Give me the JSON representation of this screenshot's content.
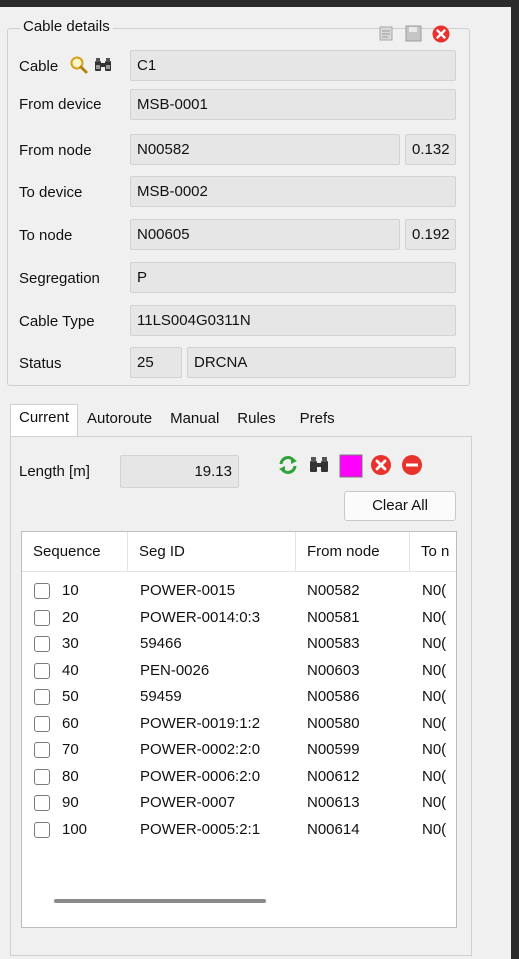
{
  "group_title": "Cable details",
  "fields": {
    "cable": {
      "label": "Cable",
      "value": "C1"
    },
    "from_device": {
      "label": "From device",
      "value": "MSB-0001"
    },
    "from_node": {
      "label": "From node",
      "value": "N00582",
      "extra": "0.132"
    },
    "to_device": {
      "label": "To device",
      "value": "MSB-0002"
    },
    "to_node": {
      "label": "To node",
      "value": "N00605",
      "extra": "0.192"
    },
    "segregation": {
      "label": "Segregation",
      "value": "P"
    },
    "cable_type": {
      "label": "Cable Type",
      "value": "11LS004G0311N"
    },
    "status": {
      "label": "Status",
      "code": "25",
      "value": "DRCNA"
    }
  },
  "tabs": [
    "Current",
    "Autoroute",
    "Manual",
    "Rules",
    "Prefs"
  ],
  "active_tab": "Current",
  "length": {
    "label": "Length [m]",
    "value": "19.13"
  },
  "clear_all_label": "Clear All",
  "colors": {
    "swatch": "#ff00ff",
    "error": "#e8322d",
    "refresh": "#2fa33a"
  },
  "table": {
    "columns": [
      "Sequence",
      "Seg ID",
      "From node",
      "To n"
    ],
    "rows": [
      [
        "10",
        "POWER-0015",
        "N00582",
        "N0("
      ],
      [
        "20",
        "POWER-0014:0:3",
        "N00581",
        "N0("
      ],
      [
        "30",
        "59466",
        "N00583",
        "N0("
      ],
      [
        "40",
        "PEN-0026",
        "N00603",
        "N0("
      ],
      [
        "50",
        "59459",
        "N00586",
        "N0("
      ],
      [
        "60",
        "POWER-0019:1:2",
        "N00580",
        "N0("
      ],
      [
        "70",
        "POWER-0002:2:0",
        "N00599",
        "N0("
      ],
      [
        "80",
        "POWER-0006:2:0",
        "N00612",
        "N0("
      ],
      [
        "90",
        "POWER-0007",
        "N00613",
        "N0("
      ],
      [
        "100",
        "POWER-0005:2:1",
        "N00614",
        "N0("
      ]
    ]
  }
}
